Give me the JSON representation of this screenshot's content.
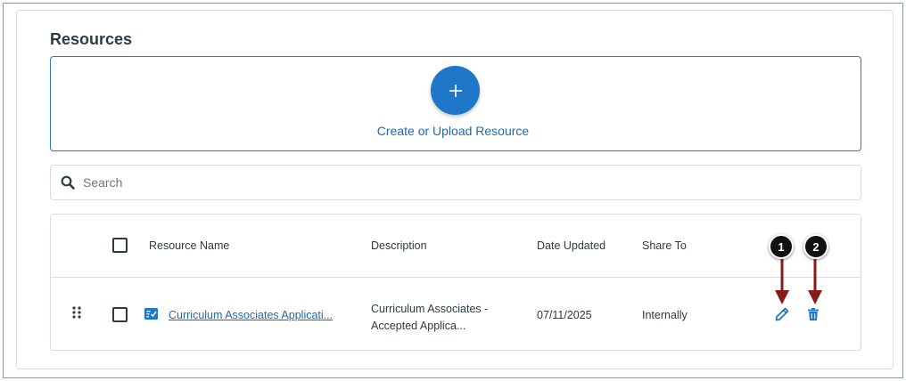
{
  "section": {
    "title": "Resources"
  },
  "upload": {
    "label": "Create or Upload Resource"
  },
  "search": {
    "placeholder": "Search"
  },
  "table": {
    "headers": {
      "name": "Resource Name",
      "description": "Description",
      "date": "Date Updated",
      "share": "Share To"
    },
    "rows": [
      {
        "name": "Curriculum Associates Applicati...",
        "description_line1": "Curriculum Associates -",
        "description_line2": "Accepted Applica...",
        "date": "07/11/2025",
        "share": "Internally"
      }
    ]
  },
  "annotations": [
    {
      "label": "1",
      "target": "edit-icon"
    },
    {
      "label": "2",
      "target": "trash-icon"
    }
  ],
  "colors": {
    "accent": "#1f77c9",
    "link": "#1b6ab3",
    "annotation_arrow": "#8b1a1a",
    "text": "#2d3b45"
  }
}
